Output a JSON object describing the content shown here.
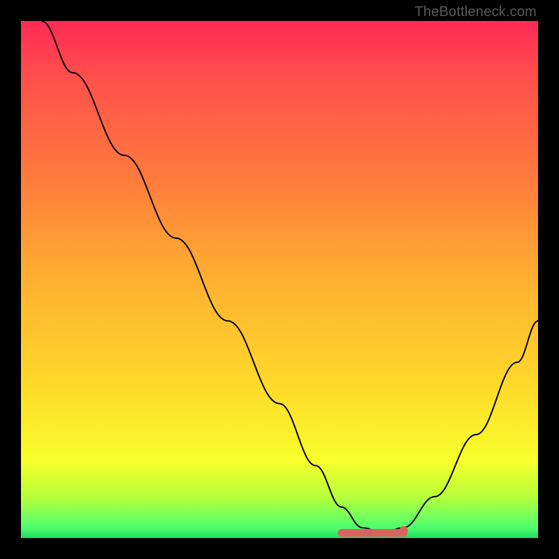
{
  "attribution": "TheBottleneck.com",
  "colors": {
    "gradient_top": "#ff2a55",
    "gradient_mid": "#ffd82a",
    "gradient_bottom": "#1fdc60",
    "curve": "#000000",
    "marker": "#d9645f",
    "frame": "#000000"
  },
  "chart_data": {
    "type": "line",
    "title": "",
    "xlabel": "",
    "ylabel": "",
    "xlim": [
      0,
      100
    ],
    "ylim": [
      0,
      100
    ],
    "grid": false,
    "legend": false,
    "series": [
      {
        "name": "bottleneck-curve",
        "x": [
          4,
          10,
          20,
          30,
          40,
          50,
          57,
          62,
          66,
          70,
          74,
          80,
          88,
          96,
          100
        ],
        "y": [
          100,
          90,
          74,
          58,
          42,
          26,
          14,
          6,
          2,
          1,
          2,
          8,
          20,
          34,
          42
        ]
      }
    ],
    "annotations": [
      {
        "name": "optimal-range",
        "type": "segment",
        "x_start": 62,
        "x_end": 74,
        "y": 1
      },
      {
        "name": "optimal-point",
        "type": "point",
        "x": 74,
        "y": 1.5
      }
    ]
  }
}
